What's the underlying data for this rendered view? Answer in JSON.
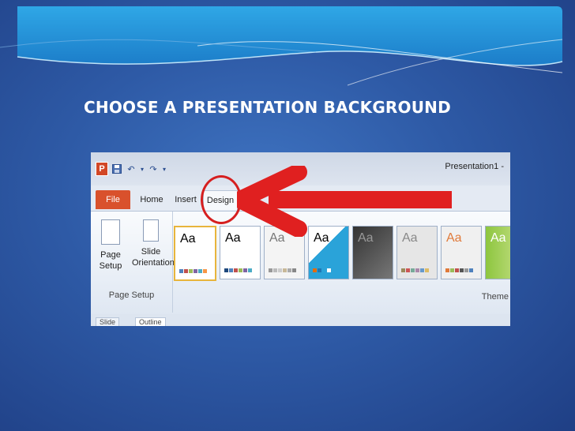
{
  "slide": {
    "title": "CHOOSE A PRESENTATION BACKGROUND"
  },
  "ppt": {
    "app_icon": "P",
    "window_title": "Presentation1 -",
    "qat": {
      "save_icon": "save-icon",
      "undo_glyph": "↶",
      "redo_glyph": "↷",
      "dropdown_glyph": "▾"
    },
    "tabs": [
      "File",
      "Home",
      "Insert",
      "Design"
    ],
    "page_setup": {
      "page_setup_label": "Page Setup",
      "slide_orientation_label": "Slide Orientation",
      "group_label": "Page Setup"
    },
    "themes": {
      "aa_label": "Aa",
      "group_label": "Theme"
    },
    "panes": {
      "slides_tab": "Slide",
      "outline_tab": "Outline"
    }
  },
  "colors": {
    "accent_red": "#d61f1f",
    "file_tab": "#d9512c",
    "selected_theme_border": "#e8b53c"
  }
}
